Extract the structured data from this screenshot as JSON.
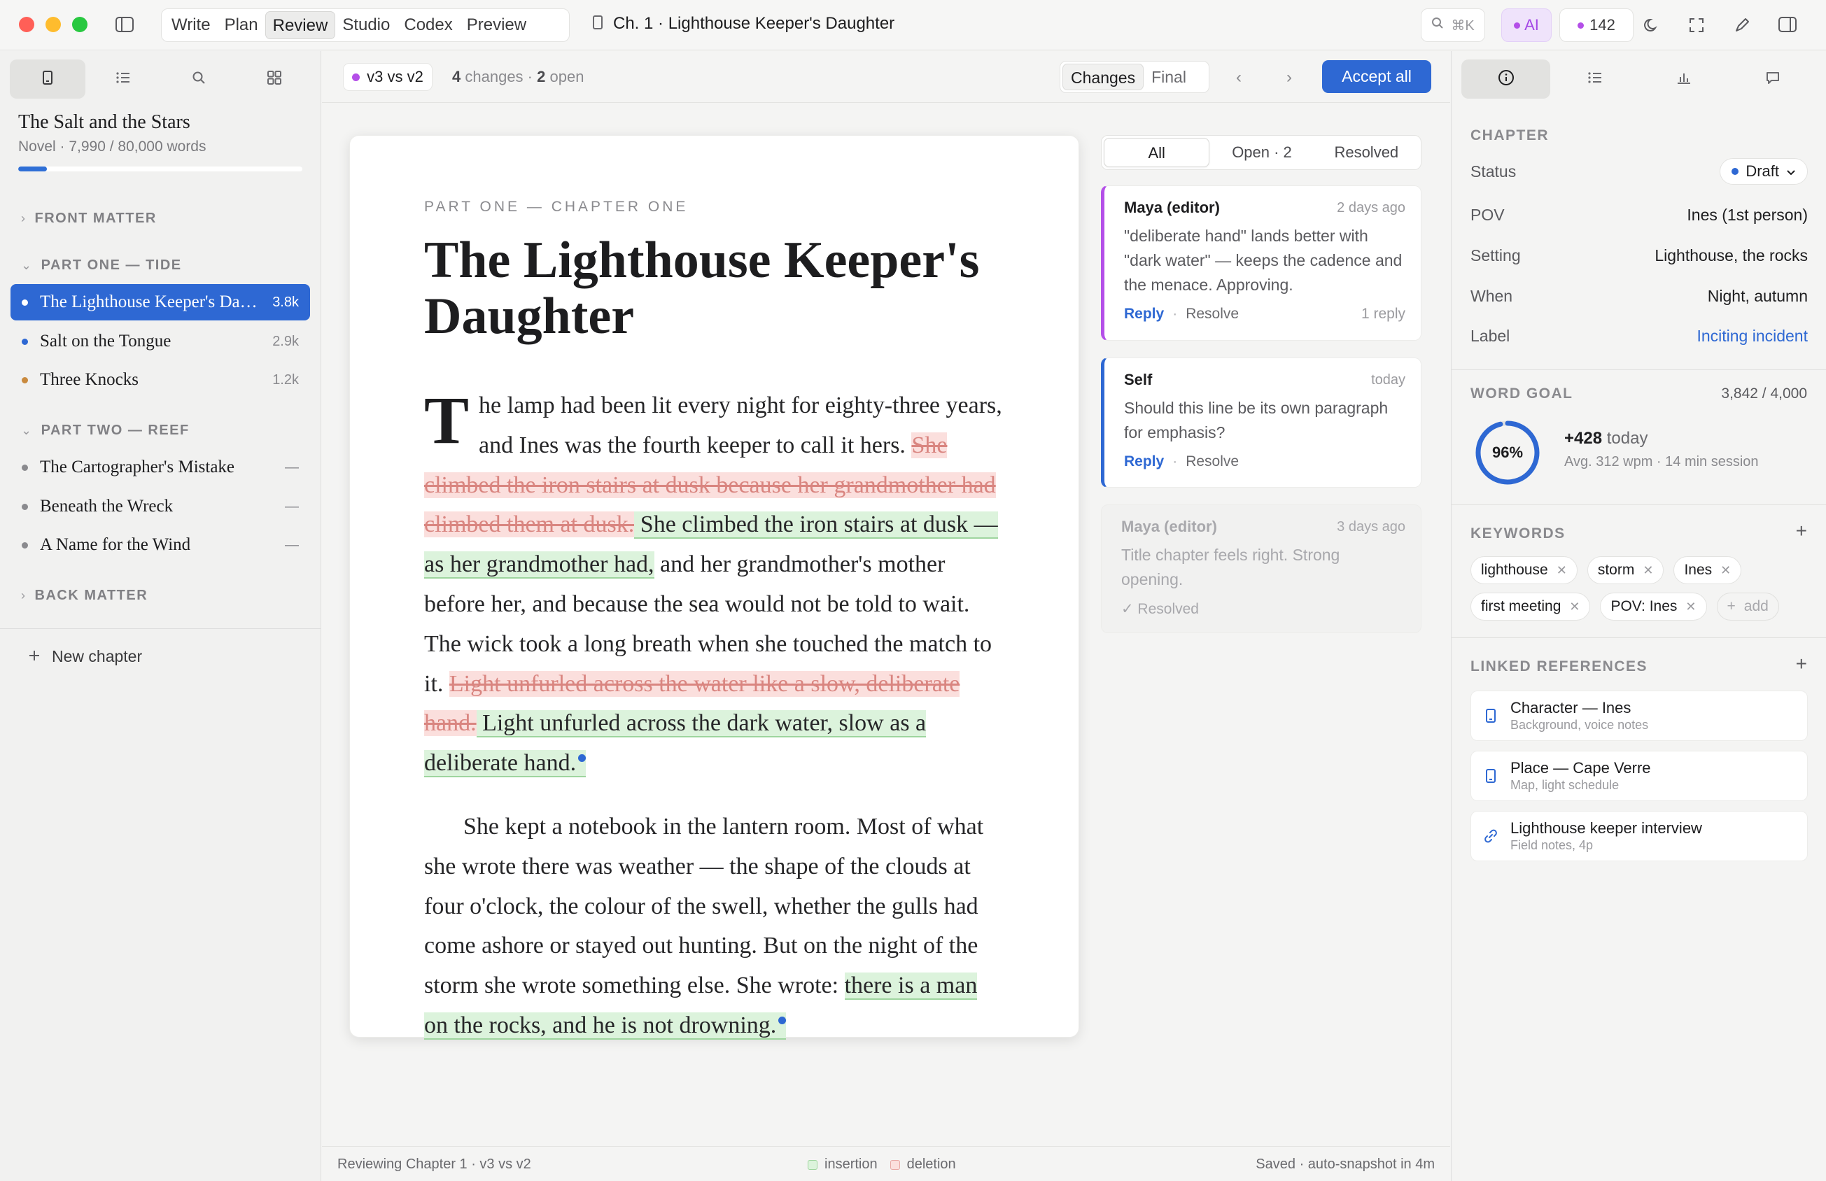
{
  "titlebar": {
    "mode_tabs": [
      "Write",
      "Plan",
      "Review",
      "Studio",
      "Codex",
      "Preview"
    ],
    "active_mode": "Review",
    "document_title": "Ch. 1 · Lighthouse Keeper's Daughter",
    "search_shortcut": "⌘K",
    "ai_label": "AI",
    "notification_count": "142"
  },
  "sidebar": {
    "book_title": "The Salt and the Stars",
    "book_meta": "Novel · 7,990 / 80,000 words",
    "progress_fraction": 0.1,
    "sections": {
      "front_matter": "FRONT MATTER",
      "part_one": "PART ONE — TIDE",
      "part_two": "PART TWO — REEF",
      "back_matter": "BACK MATTER"
    },
    "chapters": [
      {
        "name": "The Lighthouse Keeper's Daughter",
        "count": "3.8k",
        "dot": "#2e68d3"
      },
      {
        "name": "Salt on the Tongue",
        "count": "2.9k",
        "dot": "#2e68d3"
      },
      {
        "name": "Three Knocks",
        "count": "1.2k",
        "dot": "#c98a3e"
      },
      {
        "name": "The Cartographer's Mistake",
        "count": "—",
        "dot": "#8a8a8e"
      },
      {
        "name": "Beneath the Wreck",
        "count": "—",
        "dot": "#8a8a8e"
      },
      {
        "name": "A Name for the Wind",
        "count": "—",
        "dot": "#8a8a8e"
      }
    ],
    "new_chapter_label": "New chapter"
  },
  "review_toolbar": {
    "version_label": "v3 vs v2",
    "changes_count": "4",
    "changes_word": "changes",
    "open_count": "2",
    "open_word": "open",
    "view_changes": "Changes",
    "view_final": "Final",
    "accept_all": "Accept all"
  },
  "manuscript": {
    "kicker": "PART ONE — CHAPTER ONE",
    "title": "The Lighthouse Keeper's Daughter",
    "dropcap": "T",
    "p1_a": "he lamp had been lit every night for eighty-three years, and Ines was the fourth keeper to call it hers. ",
    "p1_del1": "She climbed the iron stairs at dusk because her grandmother had climbed them at dusk.",
    "p1_ins1": " She climbed the iron stairs at dusk — as her grandmother had,",
    "p1_b": " and her grandmother's mother before her, and because the sea would not be told to wait. The wick took a long breath when she touched the match to it. ",
    "p1_del2": "Light unfurled across the water like a slow, deliberate hand.",
    "p1_ins2": " Light unfurled across the dark water, slow as a deliberate hand.",
    "p2_a": "She kept a notebook in the lantern room. Most of what she wrote there was weather — the shape of the clouds at four o'clock, the colour of the swell, whether the gulls had come ashore or stayed out hunting. But on the night of the storm she wrote something else. She wrote: ",
    "p2_ins": "there is a man on the rocks, and he is not drowning."
  },
  "comments": {
    "filters": [
      "All",
      "Open · 2",
      "Resolved"
    ],
    "active_filter": "All",
    "reply_label": "Reply",
    "resolve_label": "Resolve",
    "items": [
      {
        "author": "Maya (editor)",
        "time": "2 days ago",
        "body": "\"deliberate hand\" lands better with \"dark water\" — keeps the cadence and the menace. Approving.",
        "replies": "1 reply"
      },
      {
        "author": "Self",
        "time": "today",
        "body": "Should this line be its own paragraph for emphasis?"
      },
      {
        "author": "Maya (editor)",
        "time": "3 days ago",
        "body": "Title chapter feels right. Strong opening.",
        "status": "✓ Resolved"
      }
    ]
  },
  "statusbar": {
    "left": "Reviewing Chapter 1 · v3 vs v2",
    "legend_insertion": "insertion",
    "legend_deletion": "deletion",
    "right": "Saved · auto-snapshot in 4m"
  },
  "inspector": {
    "chapter_heading": "CHAPTER",
    "status_label": "Status",
    "status_value": "Draft",
    "pov_label": "POV",
    "pov_value": "Ines (1st person)",
    "setting_label": "Setting",
    "setting_value": "Lighthouse, the rocks",
    "when_label": "When",
    "when_value": "Night, autumn",
    "label_label": "Label",
    "label_value": "Inciting incident",
    "word_goal_heading": "WORD GOAL",
    "word_goal_count": "3,842 / 4,000",
    "word_goal_percent": "96%",
    "word_goal_fraction": 0.96,
    "today_delta": "+428",
    "today_word": "today",
    "session_stats": "Avg. 312 wpm · 14 min session",
    "keywords_heading": "KEYWORDS",
    "keywords": [
      "lighthouse",
      "storm",
      "Ines",
      "first meeting",
      "POV: Ines"
    ],
    "add_keyword": "add",
    "linked_heading": "LINKED REFERENCES",
    "references": [
      {
        "title": "Character — Ines",
        "sub": "Background, voice notes",
        "icon": "document-icon"
      },
      {
        "title": "Place — Cape Verre",
        "sub": "Map, light schedule",
        "icon": "document-icon"
      },
      {
        "title": "Lighthouse keeper interview",
        "sub": "Field notes, 4p",
        "icon": "link-icon"
      }
    ]
  },
  "colors": {
    "accent": "#2e68d3",
    "insertion": "#dcf3dc",
    "deletion": "#fbdfdd",
    "ai": "#a448e6"
  }
}
